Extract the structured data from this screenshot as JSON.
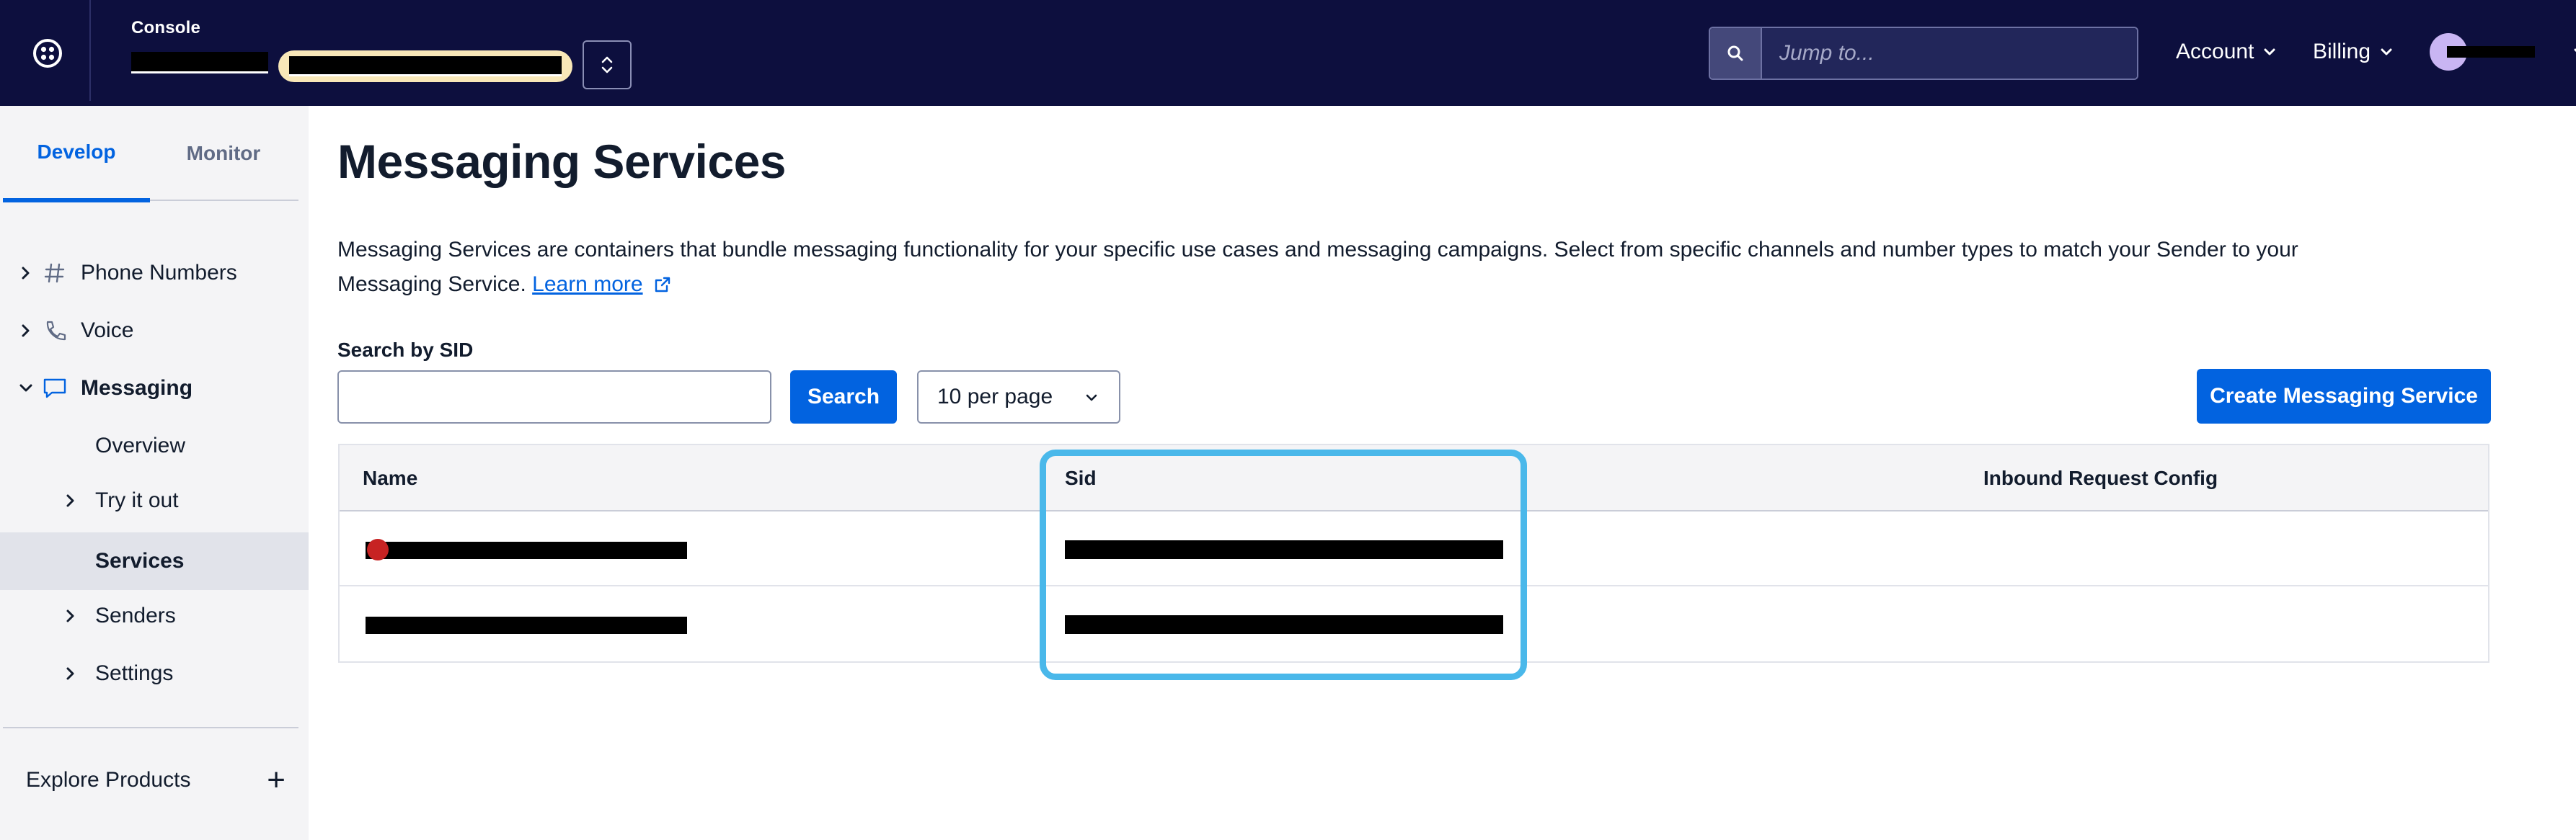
{
  "topbar": {
    "console_label": "Console",
    "jump_placeholder": "Jump to...",
    "account_label": "Account",
    "billing_label": "Billing"
  },
  "sidebar": {
    "tabs": [
      {
        "label": "Develop",
        "active": true
      },
      {
        "label": "Monitor",
        "active": false
      }
    ],
    "items": [
      {
        "label": "Phone Numbers",
        "icon": "hash-icon",
        "expandable": true,
        "expanded": false
      },
      {
        "label": "Voice",
        "icon": "phone-icon",
        "expandable": true,
        "expanded": false
      },
      {
        "label": "Messaging",
        "icon": "chat-bubble-icon",
        "expandable": true,
        "expanded": true
      },
      {
        "label": "Overview",
        "sub": true
      },
      {
        "label": "Try it out",
        "sub": true,
        "expandable": true
      },
      {
        "label": "Services",
        "sub": true,
        "selected": true
      },
      {
        "label": "Senders",
        "sub": true,
        "expandable": true
      },
      {
        "label": "Settings",
        "sub": true,
        "expandable": true
      }
    ],
    "explore_label": "Explore Products",
    "explore_action": "+"
  },
  "main": {
    "title": "Messaging Services",
    "description": "Messaging Services are containers that bundle messaging functionality for your specific use cases and messaging campaigns. Select from specific channels and number types to match your Sender to your Messaging Service.",
    "learn_more": "Learn more",
    "search_label": "Search by SID",
    "search_value": "",
    "search_button": "Search",
    "per_page": "10 per page",
    "create_button": "Create Messaging Service",
    "table": {
      "columns": [
        "Name",
        "Sid",
        "Inbound Request Config"
      ],
      "rows": [
        {
          "name": "",
          "sid": "",
          "inbound": "",
          "status_dot": true
        },
        {
          "name": "",
          "sid": "",
          "inbound": "",
          "status_dot": false
        }
      ]
    }
  },
  "colors": {
    "topbar_bg": "#0d0f3e",
    "accent_blue": "#0263e0",
    "highlight": "#4ab8ea",
    "status_red": "#c72323"
  }
}
